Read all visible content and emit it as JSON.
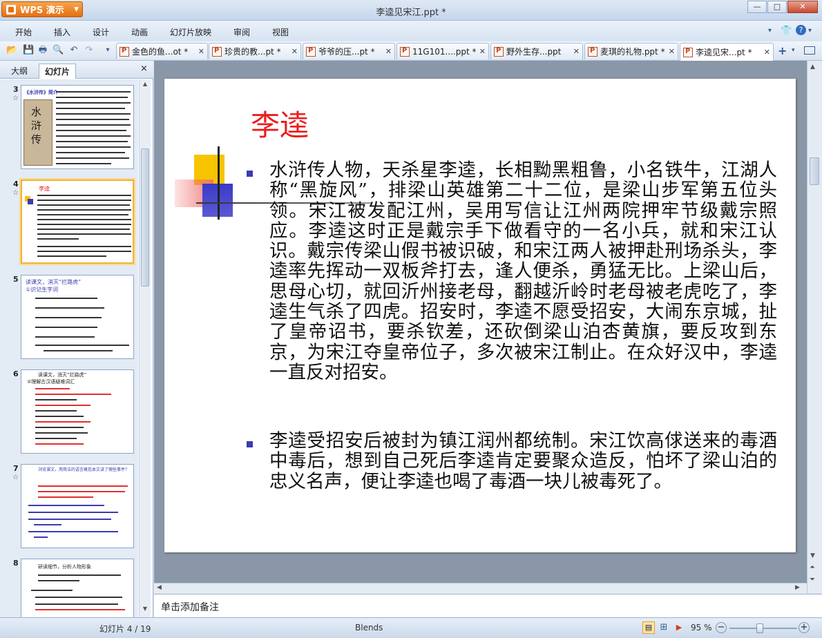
{
  "app": {
    "brand": "WPS 演示",
    "window_title": "李逵见宋江.ppt *"
  },
  "window_buttons": {
    "minimize": "—",
    "maximize": "□",
    "close": "✕"
  },
  "menu": [
    "开始",
    "插入",
    "设计",
    "动画",
    "幻灯片放映",
    "审阅",
    "视图"
  ],
  "tabs": [
    {
      "label": "金色的鱼...ot *"
    },
    {
      "label": "珍贵的教...pt *"
    },
    {
      "label": "爷爷的压...pt *"
    },
    {
      "label": "11G101....ppt *"
    },
    {
      "label": "野外生存...ppt"
    },
    {
      "label": "麦琪的礼物.ppt *"
    },
    {
      "label": "李逵见宋...pt *"
    }
  ],
  "left_pane": {
    "tab_outline": "大纲",
    "tab_slides": "幻灯片",
    "close": "×"
  },
  "thumbnails": [
    {
      "num": "3",
      "title": "《水浒传》简介"
    },
    {
      "num": "4",
      "title": "李逵"
    },
    {
      "num": "5",
      "title": "读课文，消灭“拦路虎”",
      "sub": "①识记生字词"
    },
    {
      "num": "6",
      "title": "读课文，消灭“拦路虎”",
      "sub": "②理解古汉语疑难词汇"
    },
    {
      "num": "7",
      "title": "浏览课文，用简洁的语言概括本文讲了哪些事件？"
    },
    {
      "num": "8",
      "title": "研读细节，分析人物形象"
    }
  ],
  "slide": {
    "title": "李逵",
    "bullets": [
      "水浒传人物，天杀星李逵，长相黝黑粗鲁，小名铁牛，江湖人称“黑旋风”，排梁山英雄第二十二位，是梁山步军第五位头领。宋江被发配江州，吴用写信让江州两院押牢节级戴宗照应。李逵这时正是戴宗手下做看守的一名小兵，就和宋江认识。戴宗传梁山假书被识破，和宋江两人被押赴刑场杀头，李逵率先挥动一双板斧打去，逢人便杀，勇猛无比。上梁山后，思母心切，就回沂州接老母，翻越沂岭时老母被老虎吃了，李逵生气杀了四虎。招安时，李逵不愿受招安，大闹东京城，扯了皇帝诏书，要杀钦差，还砍倒梁山泊杏黄旗，要反攻到东京，为宋江夺皇帝位子，多次被宋江制止。在众好汉中，李逵一直反对招安。",
      " 李逵受招安后被封为镇江润州都统制。宋江饮高俅送来的毒酒中毒后，想到自己死后李逵肯定要聚众造反，怕坏了梁山泊的忠义名声，便让李逵也喝了毒酒一块儿被毒死了。"
    ]
  },
  "notes_placeholder": "单击添加备注",
  "status": {
    "slide_counter": "幻灯片 4 / 19",
    "theme": "Blends",
    "zoom": "95 %"
  },
  "colors": {
    "title_red": "#ee1c1c",
    "bullet_blue": "#3b3bb2",
    "wps_orange": "#e46f12"
  }
}
